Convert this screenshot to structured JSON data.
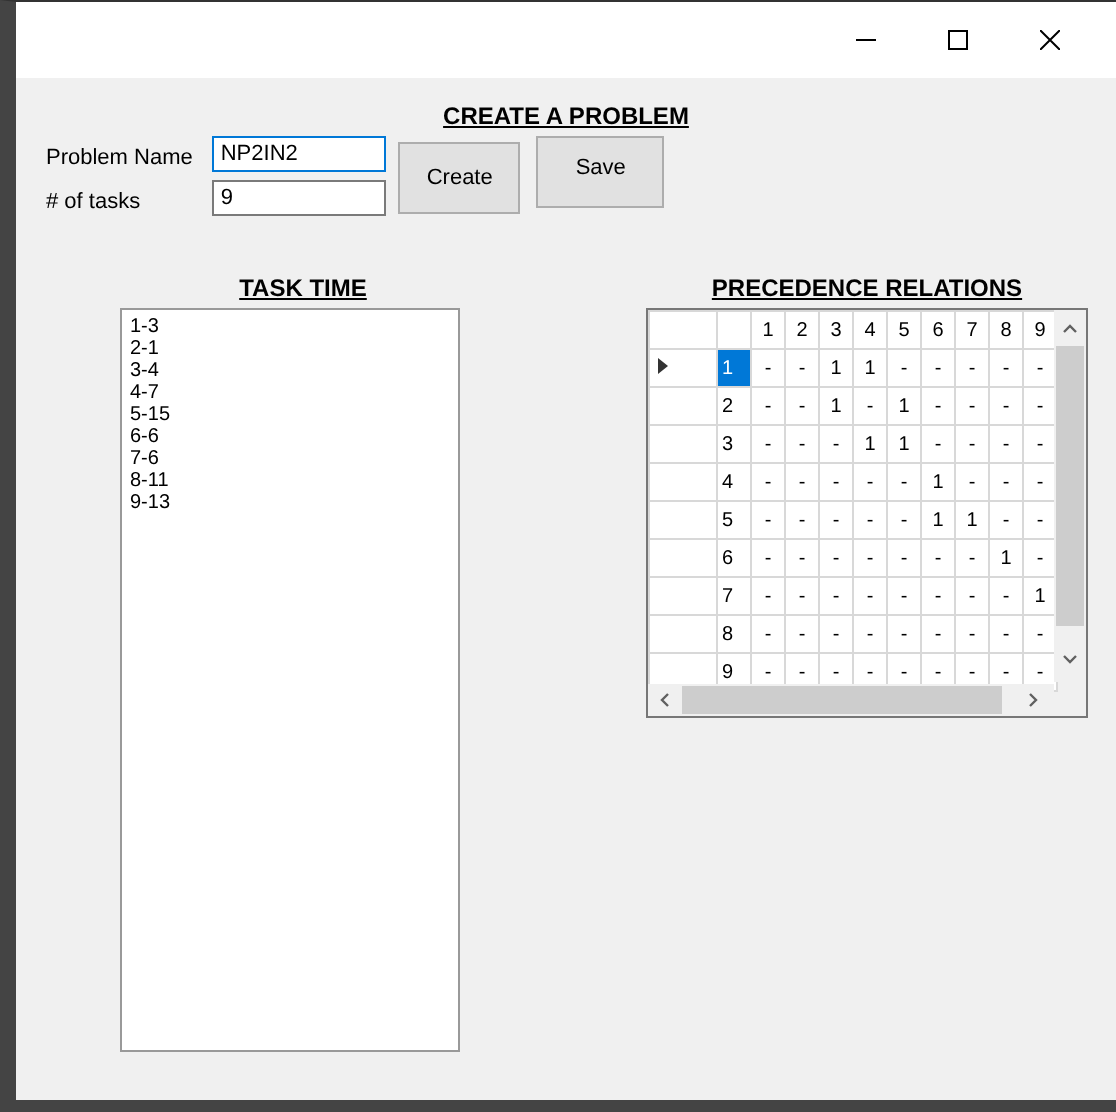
{
  "form": {
    "title": "CREATE A PROBLEM",
    "problem_name": {
      "label": "Problem Name",
      "value": "NP2IN2"
    },
    "tasks": {
      "label": "# of tasks",
      "value": "9"
    },
    "buttons": [
      "Create",
      "Save"
    ]
  },
  "task_time": {
    "title": "TASK TIME",
    "lines": [
      "1-3",
      "2-1",
      "3-4",
      "4-7",
      "5-15",
      "6-6",
      "7-6",
      "8-11",
      "9-13"
    ]
  },
  "precedence": {
    "title": "PRECEDENCE RELATIONS",
    "columns": [
      "1",
      "2",
      "3",
      "4",
      "5",
      "6",
      "7",
      "8",
      "9"
    ],
    "rows": [
      {
        "selected": true,
        "values": [
          "1",
          "-",
          "-",
          "1",
          "1",
          "-",
          "-",
          "-",
          "-",
          "-"
        ]
      },
      {
        "selected": false,
        "values": [
          "2",
          "-",
          "-",
          "1",
          "-",
          "1",
          "-",
          "-",
          "-",
          "-"
        ]
      },
      {
        "selected": false,
        "values": [
          "3",
          "-",
          "-",
          "-",
          "1",
          "1",
          "-",
          "-",
          "-",
          "-"
        ]
      },
      {
        "selected": false,
        "values": [
          "4",
          "-",
          "-",
          "-",
          "-",
          "-",
          "1",
          "-",
          "-",
          "-"
        ]
      },
      {
        "selected": false,
        "values": [
          "5",
          "-",
          "-",
          "-",
          "-",
          "-",
          "1",
          "1",
          "-",
          "-"
        ]
      },
      {
        "selected": false,
        "values": [
          "6",
          "-",
          "-",
          "-",
          "-",
          "-",
          "-",
          "-",
          "1",
          "-"
        ]
      },
      {
        "selected": false,
        "values": [
          "7",
          "-",
          "-",
          "-",
          "-",
          "-",
          "-",
          "-",
          "-",
          "1"
        ]
      },
      {
        "selected": false,
        "values": [
          "8",
          "-",
          "-",
          "-",
          "-",
          "-",
          "-",
          "-",
          "-",
          "-"
        ]
      },
      {
        "selected": false,
        "values": [
          "9",
          "-",
          "-",
          "-",
          "-",
          "-",
          "-",
          "-",
          "-",
          "-"
        ]
      }
    ]
  }
}
